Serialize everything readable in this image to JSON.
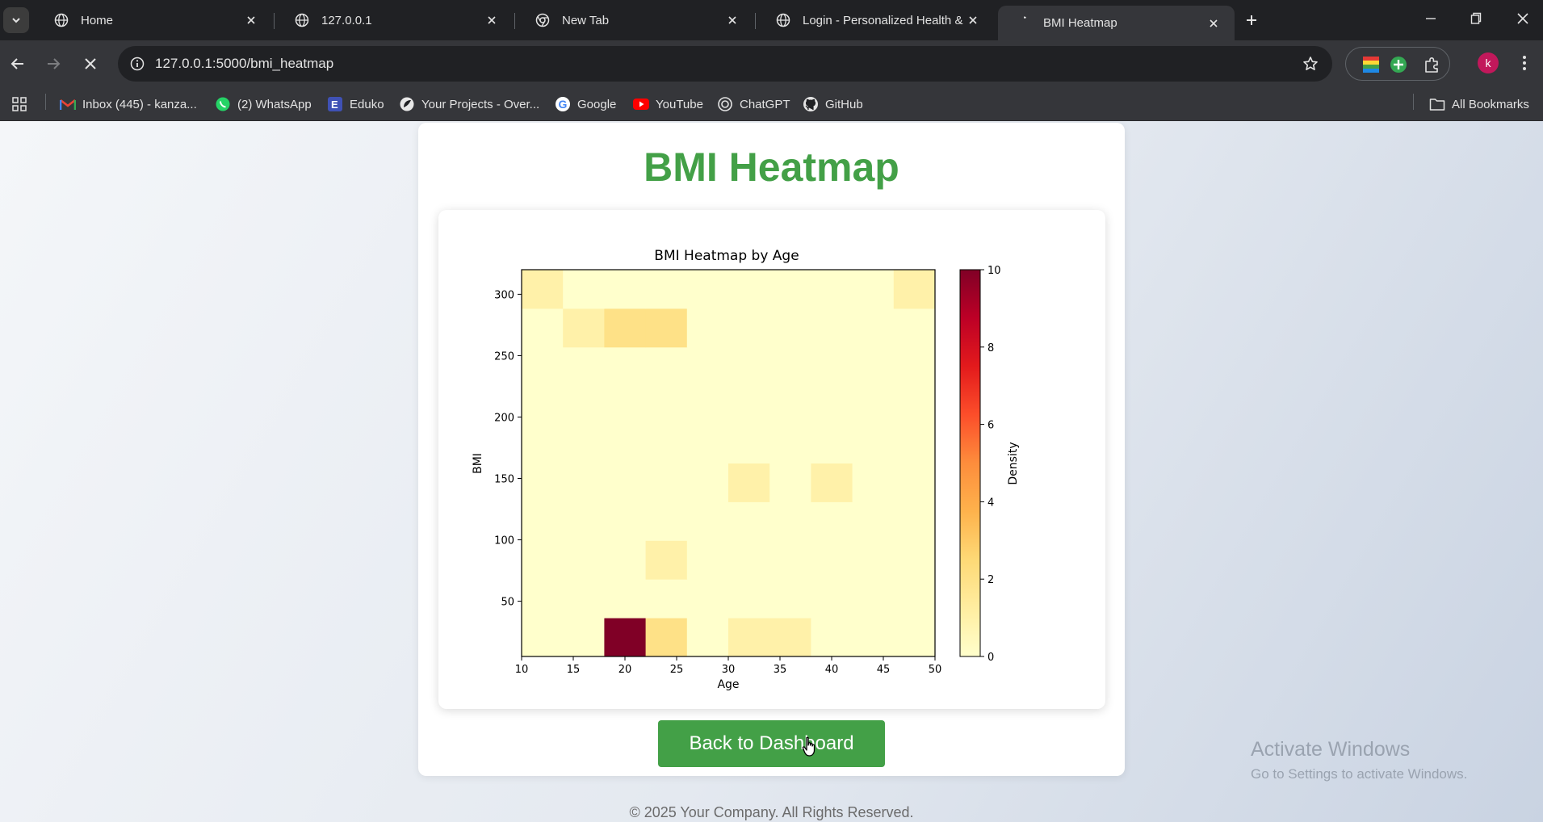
{
  "browser": {
    "tabs": [
      {
        "title": "Home",
        "icon": "globe-icon",
        "active": false
      },
      {
        "title": "127.0.0.1",
        "icon": "globe-icon",
        "active": false
      },
      {
        "title": "New Tab",
        "icon": "chrome-icon",
        "active": false
      },
      {
        "title": "Login - Personalized Health & D",
        "icon": "globe-icon",
        "active": false
      },
      {
        "title": "BMI Heatmap",
        "icon": "loading-spinner-icon",
        "active": true
      }
    ],
    "url": "127.0.0.1:5000/bmi_heatmap",
    "profile_initial": "k",
    "bookmarks": [
      {
        "label": "Inbox (445) - kanza...",
        "icon": "gmail-icon"
      },
      {
        "label": "(2) WhatsApp",
        "icon": "whatsapp-icon"
      },
      {
        "label": "Eduko",
        "icon": "eduko-icon"
      },
      {
        "label": "Your Projects - Over...",
        "icon": "overleaf-icon"
      },
      {
        "label": "Google",
        "icon": "google-icon"
      },
      {
        "label": "YouTube",
        "icon": "youtube-icon"
      },
      {
        "label": "ChatGPT",
        "icon": "chatgpt-icon"
      },
      {
        "label": "GitHub",
        "icon": "github-icon"
      }
    ],
    "all_bookmarks_label": "All Bookmarks"
  },
  "page": {
    "title": "BMI Heatmap",
    "back_button_label": "Back to Dashboard",
    "footer": "© 2025 Your Company. All Rights Reserved.",
    "colors": {
      "accent": "#43a047"
    }
  },
  "watermark": {
    "title": "Activate Windows",
    "subtitle": "Go to Settings to activate Windows."
  },
  "chart_data": {
    "type": "heatmap",
    "title": "BMI Heatmap by Age",
    "xlabel": "Age",
    "ylabel": "BMI",
    "colorbar_label": "Density",
    "colormap": "YlOrRd",
    "xlim": [
      10,
      50
    ],
    "ylim": [
      5,
      320
    ],
    "xticks": [
      10,
      15,
      20,
      25,
      30,
      35,
      40,
      45,
      50
    ],
    "yticks": [
      50,
      100,
      150,
      200,
      250,
      300
    ],
    "colorbar_ticks": [
      0,
      2,
      4,
      6,
      8,
      10
    ],
    "vmin": 0,
    "vmax": 10,
    "x_bin_edges": [
      10,
      14,
      18,
      22,
      26,
      30,
      34,
      38,
      42,
      46,
      50
    ],
    "y_bin_edges": [
      5,
      36.5,
      68,
      99.5,
      131,
      162.5,
      194,
      225.5,
      257,
      288.5,
      320
    ],
    "counts": [
      [
        0,
        0,
        10,
        2,
        0,
        1,
        1,
        0,
        0,
        0
      ],
      [
        0,
        0,
        0,
        0,
        0,
        0,
        0,
        0,
        0,
        0
      ],
      [
        0,
        0,
        0,
        1,
        0,
        0,
        0,
        0,
        0,
        0
      ],
      [
        0,
        0,
        0,
        0,
        0,
        0,
        0,
        0,
        0,
        0
      ],
      [
        0,
        0,
        0,
        0,
        0,
        1,
        0,
        1,
        0,
        0
      ],
      [
        0,
        0,
        0,
        0,
        0,
        0,
        0,
        0,
        0,
        0
      ],
      [
        0,
        0,
        0,
        0,
        0,
        0,
        0,
        0,
        0,
        0
      ],
      [
        0,
        0,
        0,
        0,
        0,
        0,
        0,
        0,
        0,
        0
      ],
      [
        0,
        1,
        2,
        2,
        0,
        0,
        0,
        0,
        0,
        0
      ],
      [
        1,
        0,
        0,
        0,
        0,
        0,
        0,
        0,
        0,
        1
      ]
    ]
  }
}
